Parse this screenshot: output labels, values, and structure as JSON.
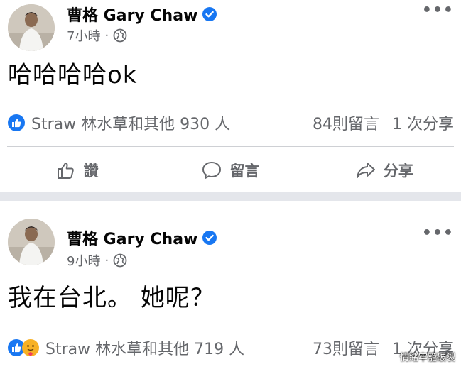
{
  "posts": [
    {
      "author": "曹格 Gary Chaw",
      "time": "7小時",
      "separator": "·",
      "content": "哈哈哈哈ok",
      "reaction_summary": "Straw 林水草和其他 930 人",
      "comments": "84則留言",
      "shares": "1 次分享",
      "reaction_icons": [
        "like-icon"
      ],
      "actions": {
        "like": "讚",
        "comment": "留言",
        "share": "分享"
      }
    },
    {
      "author": "曹格 Gary Chaw",
      "time": "9小時",
      "separator": "·",
      "content": "我在台北。 她呢？",
      "reaction_summary": "Straw 林水草和其他 719 人",
      "comments": "73則留言",
      "shares": "1 次分享",
      "reaction_icons": [
        "like-icon",
        "care-icon"
      ]
    }
  ],
  "more_glyph": "•••",
  "watermark": "情緒牢籠破裂",
  "colors": {
    "accent": "#1877f2",
    "secondary_text": "#65676b",
    "separator": "#e4e6eb"
  }
}
